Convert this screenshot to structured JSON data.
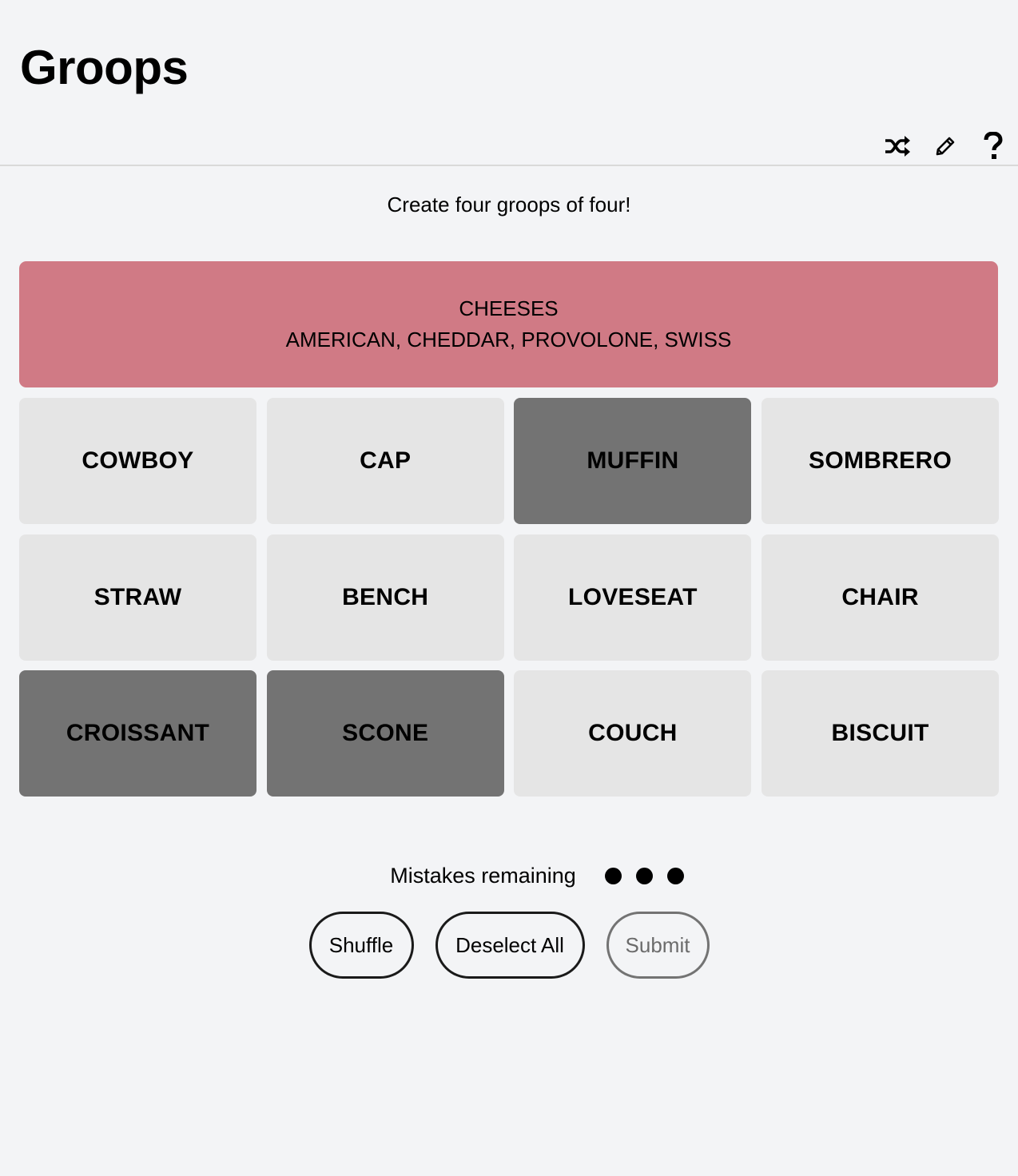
{
  "header": {
    "title": "Groops"
  },
  "header_icons": [
    {
      "name": "shuffle-icon"
    },
    {
      "name": "pencil-icon"
    },
    {
      "name": "help-icon"
    }
  ],
  "subtitle": "Create four groops of four!",
  "solved_groups": [
    {
      "category": "CHEESES",
      "members": "AMERICAN, CHEDDAR, PROVOLONE, SWISS",
      "color": "#d07a85"
    }
  ],
  "tiles": [
    {
      "word": "COWBOY",
      "selected": false
    },
    {
      "word": "CAP",
      "selected": false
    },
    {
      "word": "MUFFIN",
      "selected": true
    },
    {
      "word": "SOMBRERO",
      "selected": false
    },
    {
      "word": "STRAW",
      "selected": false
    },
    {
      "word": "BENCH",
      "selected": false
    },
    {
      "word": "LOVESEAT",
      "selected": false
    },
    {
      "word": "CHAIR",
      "selected": false
    },
    {
      "word": "CROISSANT",
      "selected": true
    },
    {
      "word": "SCONE",
      "selected": true
    },
    {
      "word": "COUCH",
      "selected": false
    },
    {
      "word": "BISCUIT",
      "selected": false
    }
  ],
  "mistakes": {
    "label": "Mistakes remaining",
    "remaining": 3
  },
  "actions": {
    "shuffle_label": "Shuffle",
    "deselect_label": "Deselect All",
    "submit_label": "Submit"
  },
  "colors": {
    "background": "#f3f4f6",
    "tile": "#e5e5e5",
    "tile_selected": "#737373",
    "solved_group": "#d07a85"
  }
}
